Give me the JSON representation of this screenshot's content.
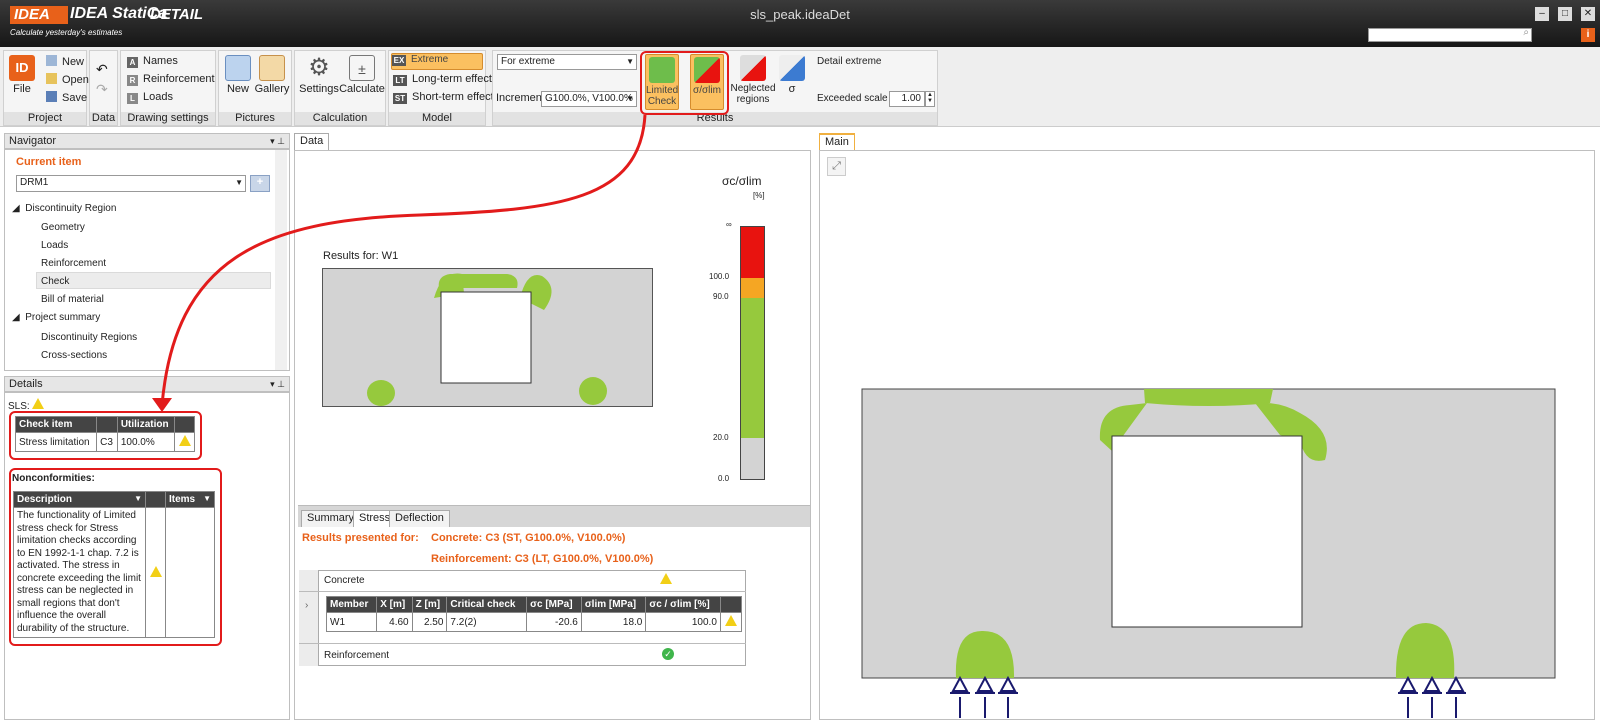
{
  "app": {
    "brand": "IDEA StatiCa",
    "product": "DETAIL",
    "tagline": "Calculate yesterday's estimates",
    "window_title": "sls_peak.ideaDet",
    "brand_color": "#e8611a"
  },
  "ribbon": {
    "project": {
      "label": "Project",
      "file": "File",
      "new": "New",
      "open": "Open",
      "save": "Save"
    },
    "data": {
      "label": "Data"
    },
    "drawing": {
      "label": "Drawing settings",
      "names": "Names",
      "reinforcement": "Reinforcement",
      "loads": "Loads"
    },
    "pictures": {
      "label": "Pictures",
      "new": "New",
      "gallery": "Gallery"
    },
    "calculation": {
      "label": "Calculation",
      "settings": "Settings",
      "calculate": "Calculate"
    },
    "model": {
      "label": "Model",
      "extreme": "Extreme",
      "longterm": "Long-term effect",
      "shortterm": "Short-term effect"
    },
    "results": {
      "label": "Results",
      "for_extreme": "For extreme",
      "increment_label": "Increment",
      "increment_value": "G100.0%, V100.0%",
      "limited_check": "Limited Check",
      "sigma_lim": "σ/σlim",
      "neglected": "Neglected regions",
      "sigma": "σ",
      "detail_extreme": "Detail extreme",
      "exceeded_scale_label": "Exceeded scale",
      "exceeded_scale_value": "1.00"
    }
  },
  "navigator": {
    "title": "Navigator",
    "current_item": "Current item",
    "item_value": "DRM1",
    "tree": [
      "Discontinuity Region",
      "Geometry",
      "Loads",
      "Reinforcement",
      "Check",
      "Bill of material",
      "Project summary",
      "Discontinuity Regions",
      "Cross-sections"
    ]
  },
  "details": {
    "title": "Details",
    "sls": "SLS:",
    "check_table": {
      "headers": [
        "Check item",
        "",
        "Utilization"
      ],
      "row": [
        "Stress limitation",
        "C3",
        "100.0%"
      ]
    },
    "nonconf_title": "Nonconformities:",
    "nonconf_headers": [
      "Description",
      "Items"
    ],
    "nonconf_text": "The functionality of Limited stress check for Stress limitation checks according to EN 1992-1-1 chap. 7.2 is activated. The stress in concrete exceeding the limit stress can be neglected in small regions that don't influence the overall durability of the structure."
  },
  "data_panel": {
    "tab": "Data",
    "results_for": "Results for: W1",
    "legend": {
      "title": "σc/σlim",
      "unit": "[%]",
      "ticks": [
        "∞",
        "100.0",
        "90.0",
        "20.0",
        "0.0"
      ]
    },
    "tabs": [
      "Summary",
      "Stress",
      "Deflection"
    ],
    "presented_for": "Results presented for:",
    "concrete_line": "Concrete: C3 (ST, G100.0%, V100.0%)",
    "reinf_line": "Reinforcement: C3 (LT, G100.0%, V100.0%)",
    "concrete": "Concrete",
    "table_headers": [
      "Member",
      "X [m]",
      "Z [m]",
      "Critical check",
      "σc [MPa]",
      "σlim [MPa]",
      "σc / σlim [%]"
    ],
    "table_row": [
      "W1",
      "4.60",
      "2.50",
      "7.2(2)",
      "-20.6",
      "18.0",
      "100.0"
    ],
    "reinforcement": "Reinforcement"
  },
  "main_panel": {
    "tab": "Main"
  },
  "colors": {
    "green": "#96c93d",
    "red": "#e8130f",
    "orange": "#f5a623",
    "grey": "#d3d3d3",
    "highlight": "#fbc060",
    "annot": "#e21b1b"
  }
}
